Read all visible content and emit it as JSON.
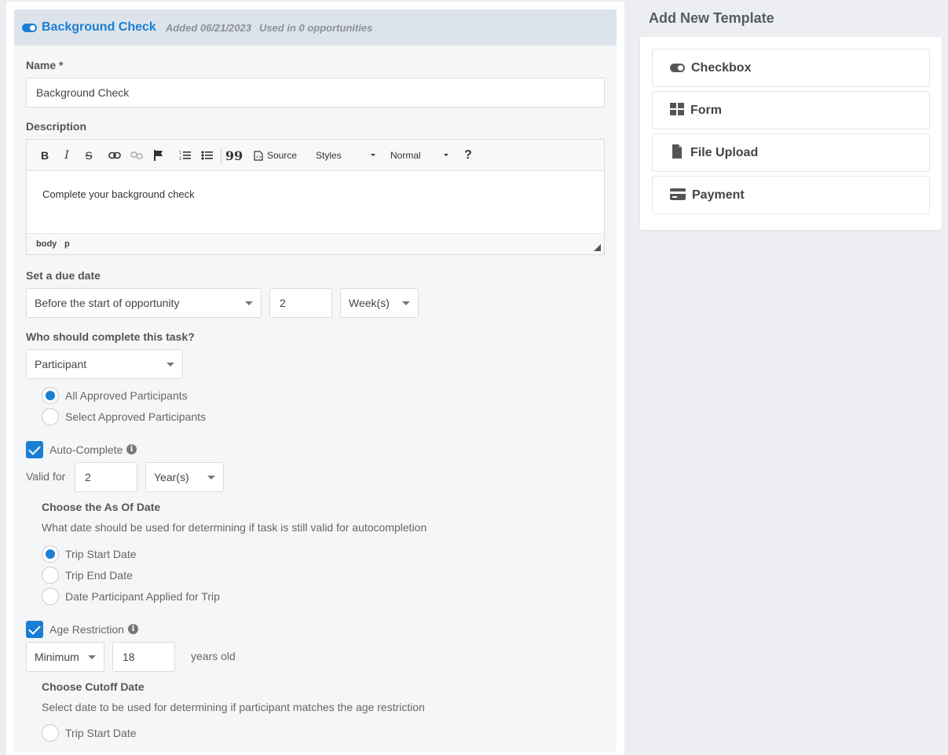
{
  "task": {
    "title": "Background Check",
    "added": "Added 06/21/2023",
    "usage": "Used in 0 opportunities"
  },
  "name_field": {
    "label": "Name *",
    "value": "Background Check"
  },
  "description": {
    "label": "Description",
    "toolbar": {
      "bold": "B",
      "italic": "I",
      "strike": "S",
      "quote": "99",
      "source": "Source",
      "styles": "Styles",
      "format": "Normal",
      "help": "?"
    },
    "content": "Complete your background check",
    "path": [
      "body",
      "p"
    ]
  },
  "due_date": {
    "label": "Set a due date",
    "relation": "Before the start of opportunity",
    "amount": "2",
    "unit": "Week(s)"
  },
  "assignee": {
    "label": "Who should complete this task?",
    "role": "Participant",
    "options": [
      {
        "label": "All Approved Participants",
        "selected": true
      },
      {
        "label": "Select Approved Participants",
        "selected": false
      }
    ]
  },
  "auto_complete": {
    "label": "Auto-Complete",
    "checked": true,
    "valid_for_label": "Valid for",
    "valid_amount": "2",
    "valid_unit": "Year(s)",
    "as_of_title": "Choose the As Of Date",
    "as_of_desc": "What date should be used for determining if task is still valid for autocompletion",
    "options": [
      {
        "label": "Trip Start Date",
        "selected": true
      },
      {
        "label": "Trip End Date",
        "selected": false
      },
      {
        "label": "Date Participant Applied for Trip",
        "selected": false
      }
    ]
  },
  "age_restriction": {
    "label": "Age Restriction",
    "checked": true,
    "mode": "Minimum",
    "age": "18",
    "suffix": "years old",
    "cutoff_title": "Choose Cutoff Date",
    "cutoff_desc": "Select date to be used for determining if participant matches the age restriction",
    "options": [
      {
        "label": "Trip Start Date",
        "selected": false
      }
    ]
  },
  "templates": {
    "title": "Add New Template",
    "items": [
      {
        "label": "Checkbox",
        "icon": "toggle-icon"
      },
      {
        "label": "Form",
        "icon": "grid-icon"
      },
      {
        "label": "File Upload",
        "icon": "file-icon"
      },
      {
        "label": "Payment",
        "icon": "credit-card-icon"
      }
    ]
  },
  "colors": {
    "accent": "#1a7fd4",
    "header_bg": "#dde3ea",
    "page_bg": "#eceef1"
  }
}
